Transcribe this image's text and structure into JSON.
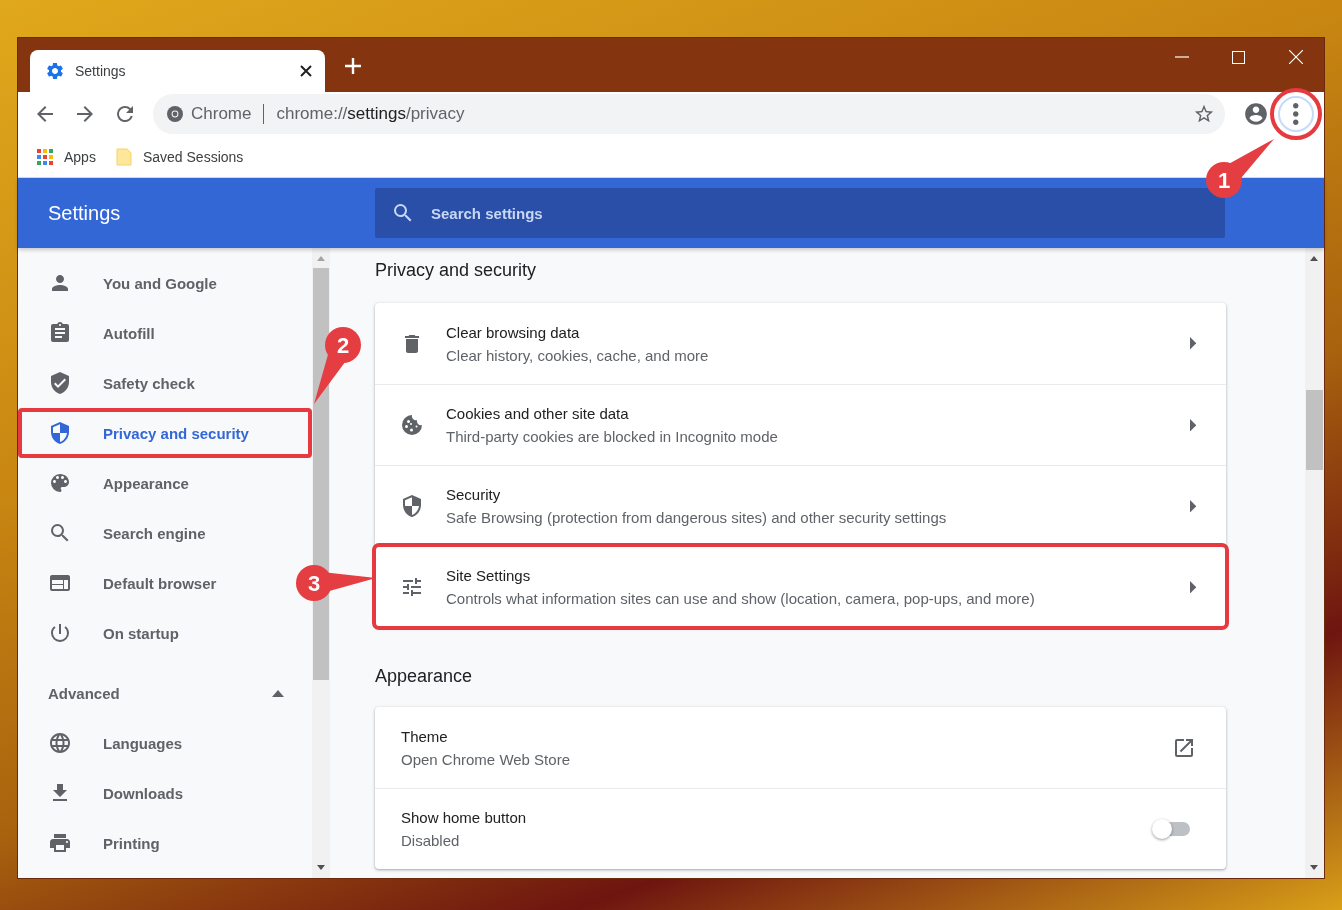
{
  "tabs": [
    {
      "title": "Settings",
      "selected": true
    }
  ],
  "toolbar": {
    "site_label": "Chrome",
    "url": "chrome://**settings**/privacy",
    "menu_button": {
      "highlighted": true
    }
  },
  "bookmarks": [
    {
      "label": "Apps",
      "kind": "apps"
    },
    {
      "label": "Saved Sessions",
      "kind": "folder"
    }
  ],
  "header": {
    "title": "Settings",
    "search": {
      "placeholder": "Search settings"
    }
  },
  "sidebar": {
    "items": [
      {
        "label": "You and Google",
        "selected": false,
        "highlighted": false
      },
      {
        "label": "Autofill",
        "selected": false,
        "highlighted": false
      },
      {
        "label": "Safety check",
        "selected": false,
        "highlighted": false
      },
      {
        "label": "Privacy and security",
        "selected": true,
        "highlighted": true
      },
      {
        "label": "Appearance",
        "selected": false,
        "highlighted": false
      },
      {
        "label": "Search engine",
        "selected": false,
        "highlighted": false
      },
      {
        "label": "Default browser",
        "selected": false,
        "highlighted": false
      },
      {
        "label": "On startup",
        "selected": false,
        "highlighted": false
      }
    ],
    "advanced": {
      "label": "Advanced",
      "expanded": true,
      "items": [
        {
          "label": "Languages",
          "selected": false
        },
        {
          "label": "Downloads",
          "selected": false
        },
        {
          "label": "Printing",
          "selected": false
        }
      ]
    }
  },
  "sections": [
    {
      "title": "Privacy and security",
      "rows": [
        {
          "title": "Clear browsing data",
          "subtitle": "Clear history, cookies, cache, and more",
          "kind": "link",
          "highlighted": false
        },
        {
          "title": "Cookies and other site data",
          "subtitle": "Third-party cookies are blocked in Incognito mode",
          "kind": "link",
          "highlighted": false
        },
        {
          "title": "Security",
          "subtitle": "Safe Browsing (protection from dangerous sites) and other security settings",
          "kind": "link",
          "highlighted": false
        },
        {
          "title": "Site Settings",
          "subtitle": "Controls what information sites can use and show (location, camera, pop-ups, and more)",
          "kind": "link",
          "highlighted": true
        }
      ]
    },
    {
      "title": "Appearance",
      "rows": [
        {
          "title": "Theme",
          "subtitle": "Open Chrome Web Store",
          "kind": "external",
          "highlighted": false
        },
        {
          "title": "Show home button",
          "subtitle": "Disabled",
          "kind": "toggle",
          "on": false,
          "highlighted": false
        }
      ]
    }
  ],
  "annotations": [
    {
      "number": "1"
    },
    {
      "number": "2"
    },
    {
      "number": "3"
    }
  ]
}
